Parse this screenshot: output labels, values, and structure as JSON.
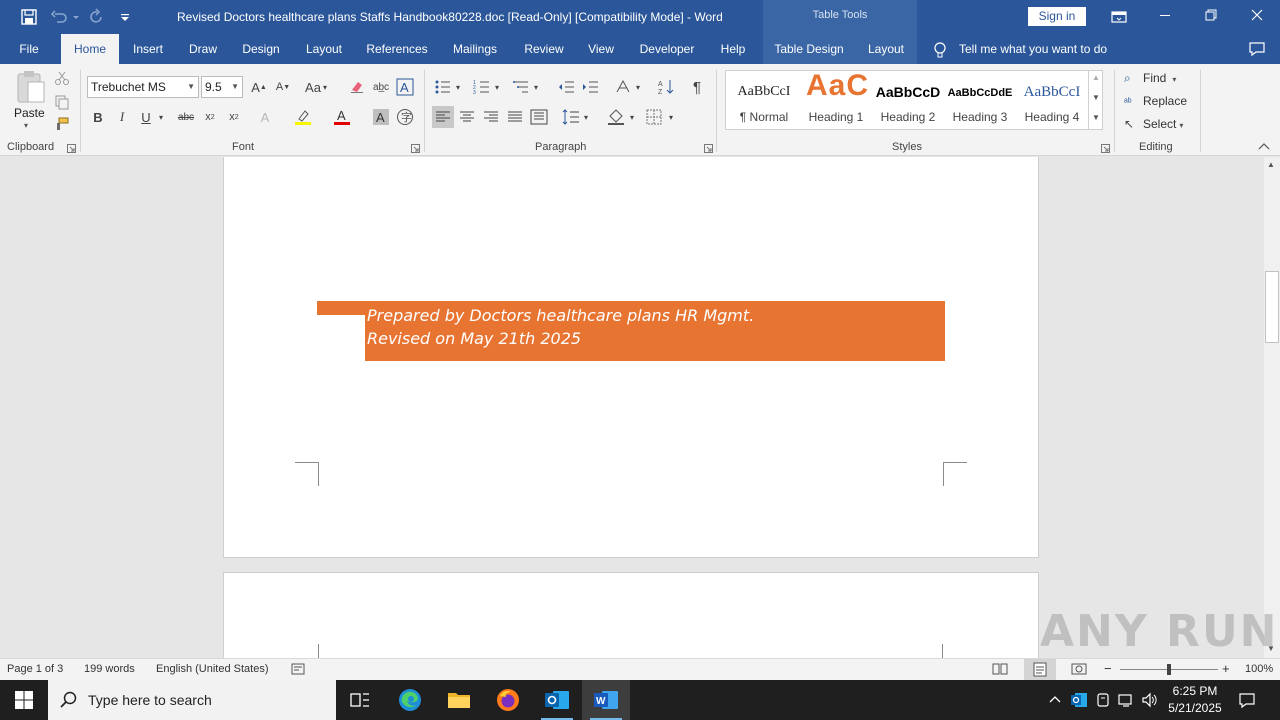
{
  "window": {
    "title": "Revised Doctors healthcare plans Staffs Handbook80228.doc [Read-Only] [Compatibility Mode]  -  Word",
    "contextual_tab_group": "Table Tools",
    "sign_in": "Sign in"
  },
  "tabs": [
    "File",
    "Home",
    "Insert",
    "Draw",
    "Design",
    "Layout",
    "References",
    "Mailings",
    "Review",
    "View",
    "Developer",
    "Help",
    "Table Design",
    "Layout"
  ],
  "tell_me": "Tell me what you want to do",
  "ribbon": {
    "clipboard": {
      "paste": "Paste",
      "label": "Clipboard"
    },
    "font": {
      "family": "Trebuchet MS",
      "size": "9.5",
      "label": "Font",
      "case_button": "Aa"
    },
    "paragraph": {
      "label": "Paragraph"
    },
    "styles": {
      "label": "Styles",
      "items": [
        {
          "sample": "AaBbCcI",
          "name": "¶ Normal"
        },
        {
          "sample": "AaC",
          "name": "Heading 1"
        },
        {
          "sample": "AaBbCcD",
          "name": "Heading 2"
        },
        {
          "sample": "AaBbCcDdE",
          "name": "Heading 3"
        },
        {
          "sample": "AaBbCcI",
          "name": "Heading 4"
        }
      ]
    },
    "editing": {
      "label": "Editing",
      "find": "Find",
      "replace": "Replace",
      "select": "Select"
    }
  },
  "document": {
    "banner_line1": "Prepared by Doctors healthcare plans HR Mgmt.",
    "banner_line2": "Revised on May 21th 2025",
    "accent_color": "#e87432"
  },
  "status": {
    "page": "Page 1 of 3",
    "words": "199 words",
    "language": "English (United States)",
    "zoom": "100%"
  },
  "taskbar": {
    "search_placeholder": "Type here to search",
    "time": "6:25 PM",
    "date": "5/21/2025"
  },
  "watermark": "ANY RUN"
}
